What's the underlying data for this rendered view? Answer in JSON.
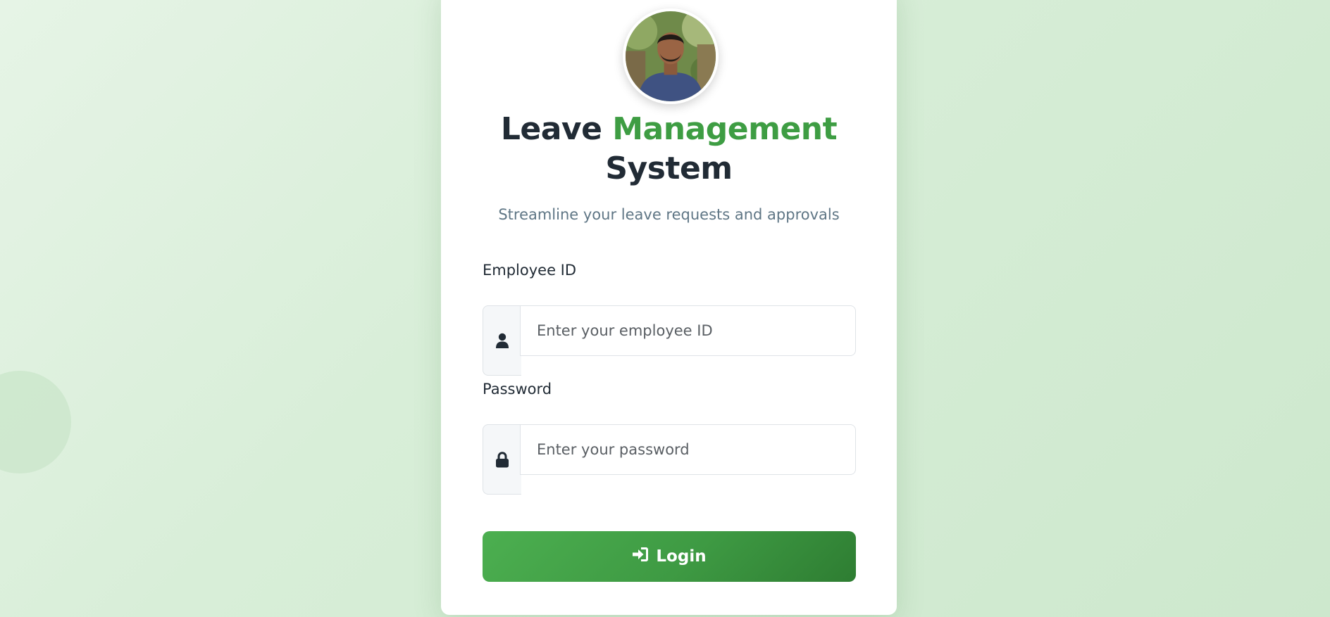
{
  "header": {
    "title_part1": "Leave",
    "title_accent": "Management",
    "title_part2": "System",
    "subtitle": "Streamline your leave requests and approvals"
  },
  "form": {
    "employee_id": {
      "label": "Employee ID",
      "placeholder": "Enter your employee ID",
      "value": "",
      "icon": "user-icon"
    },
    "password": {
      "label": "Password",
      "placeholder": "Enter your password",
      "value": "",
      "icon": "lock-icon"
    },
    "login_button": {
      "label": "Login",
      "icon": "sign-in-icon"
    }
  },
  "colors": {
    "accent": "#3e9d43",
    "title": "#212b35",
    "subtitle": "#5f7685",
    "button_start": "#4caf50",
    "button_end": "#2e7d32"
  }
}
